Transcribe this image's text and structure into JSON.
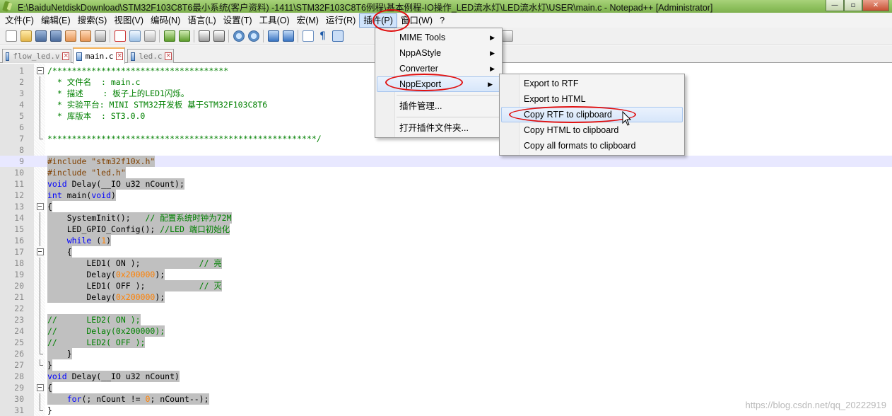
{
  "window": {
    "title": "E:\\BaiduNetdiskDownload\\STM32F103C8T6最小系统(客户资料) -1411\\STM32F103C8T6例程\\基本例程-IO操作_LED流水灯\\LED流水灯\\USER\\main.c - Notepad++ [Administrator]",
    "minimize_glyph": "—",
    "restore_glyph": "▫",
    "close_glyph": "✕"
  },
  "menubar": {
    "items": [
      "文件(F)",
      "编辑(E)",
      "搜索(S)",
      "视图(V)",
      "编码(N)",
      "语言(L)",
      "设置(T)",
      "工具(O)",
      "宏(M)",
      "运行(R)",
      "插件(P)",
      "窗口(W)",
      "?"
    ],
    "active_index": 10
  },
  "tabs": [
    {
      "label": "flow_led.v",
      "active": false
    },
    {
      "label": "main.c",
      "active": true
    },
    {
      "label": "led.c",
      "active": false
    }
  ],
  "plugins_menu": {
    "items": [
      {
        "label": "MIME Tools",
        "submenu": true
      },
      {
        "label": "NppAStyle",
        "submenu": true
      },
      {
        "label": "Converter",
        "submenu": true
      },
      {
        "label": "NppExport",
        "submenu": true,
        "highlighted": true
      },
      {
        "separator": true
      },
      {
        "label": "插件管理...",
        "submenu": false
      },
      {
        "separator": true
      },
      {
        "label": "打开插件文件夹...",
        "submenu": false
      }
    ],
    "arrow_glyph": "▶"
  },
  "nppexport_menu": {
    "items": [
      {
        "label": "Export to RTF",
        "highlighted": false
      },
      {
        "label": "Export to HTML",
        "highlighted": false
      },
      {
        "label": "Copy RTF to clipboard",
        "highlighted": true
      },
      {
        "label": "Copy HTML to clipboard",
        "highlighted": false
      },
      {
        "label": "Copy all formats to clipboard",
        "highlighted": false
      }
    ]
  },
  "editor": {
    "lines": [
      {
        "n": "1",
        "fold": "box",
        "sel": false,
        "tokens": [
          [
            "cmt",
            "/************************************"
          ]
        ]
      },
      {
        "n": "2",
        "fold": "vline",
        "sel": false,
        "tokens": [
          [
            "cmt",
            "  * 文件名  : main.c"
          ]
        ]
      },
      {
        "n": "3",
        "fold": "vline",
        "sel": false,
        "tokens": [
          [
            "cmt",
            "  * 描述    : 板子上的LED1闪烁。"
          ]
        ]
      },
      {
        "n": "4",
        "fold": "vline",
        "sel": false,
        "tokens": [
          [
            "cmt",
            "  * 实验平台: MINI STM32开发板 基于STM32F103C8T6"
          ]
        ]
      },
      {
        "n": "5",
        "fold": "vline",
        "sel": false,
        "tokens": [
          [
            "cmt",
            "  * 库版本  : ST3.0.0"
          ]
        ]
      },
      {
        "n": "6",
        "fold": "vline",
        "sel": false,
        "tokens": [
          [
            "cmt",
            ""
          ]
        ]
      },
      {
        "n": "7",
        "fold": "end",
        "sel": false,
        "tokens": [
          [
            "cmt",
            "*******************************************************/"
          ]
        ]
      },
      {
        "n": "8",
        "fold": "",
        "sel": false,
        "tokens": [
          [
            "txt",
            ""
          ]
        ]
      },
      {
        "n": "9",
        "fold": "",
        "sel": true,
        "current": true,
        "tokens": [
          [
            "pre",
            "#include \"stm32f10x.h\""
          ]
        ]
      },
      {
        "n": "10",
        "fold": "",
        "sel": true,
        "tokens": [
          [
            "pre",
            "#include \"led.h\""
          ]
        ]
      },
      {
        "n": "11",
        "fold": "",
        "sel": true,
        "tokens": [
          [
            "kw",
            "void"
          ],
          [
            "txt",
            " Delay(__IO u32 nCount);"
          ]
        ]
      },
      {
        "n": "12",
        "fold": "",
        "sel": true,
        "tokens": [
          [
            "kw",
            "int"
          ],
          [
            "txt",
            " main("
          ],
          [
            "kw",
            "void"
          ],
          [
            "txt",
            ")"
          ]
        ]
      },
      {
        "n": "13",
        "fold": "box",
        "sel": true,
        "tokens": [
          [
            "txt",
            "{"
          ]
        ]
      },
      {
        "n": "14",
        "fold": "vline",
        "sel": true,
        "tokens": [
          [
            "txt",
            "    SystemInit();   "
          ],
          [
            "cmt",
            "// 配置系统时钟为72M"
          ]
        ]
      },
      {
        "n": "15",
        "fold": "vline",
        "sel": true,
        "tokens": [
          [
            "txt",
            "    LED_GPIO_Config(); "
          ],
          [
            "cmt",
            "//LED 端口初始化"
          ]
        ]
      },
      {
        "n": "16",
        "fold": "vline",
        "sel": true,
        "tokens": [
          [
            "txt",
            "    "
          ],
          [
            "kw",
            "while"
          ],
          [
            "txt",
            " ("
          ],
          [
            "num",
            "1"
          ],
          [
            "txt",
            ")"
          ]
        ]
      },
      {
        "n": "17",
        "fold": "box",
        "sel": true,
        "tokens": [
          [
            "txt",
            "    {"
          ]
        ]
      },
      {
        "n": "18",
        "fold": "vline",
        "sel": true,
        "tokens": [
          [
            "txt",
            "        LED1( ON );            "
          ],
          [
            "cmt",
            "// 亮"
          ]
        ]
      },
      {
        "n": "19",
        "fold": "vline",
        "sel": true,
        "tokens": [
          [
            "txt",
            "        Delay("
          ],
          [
            "num",
            "0x200000"
          ],
          [
            "txt",
            ");"
          ]
        ]
      },
      {
        "n": "20",
        "fold": "vline",
        "sel": true,
        "tokens": [
          [
            "txt",
            "        LED1( OFF );           "
          ],
          [
            "cmt",
            "// 灭"
          ]
        ]
      },
      {
        "n": "21",
        "fold": "vline",
        "sel": true,
        "tokens": [
          [
            "txt",
            "        Delay("
          ],
          [
            "num",
            "0x200000"
          ],
          [
            "txt",
            ");"
          ]
        ]
      },
      {
        "n": "22",
        "fold": "vline",
        "sel": false,
        "tokens": [
          [
            "txt",
            ""
          ]
        ]
      },
      {
        "n": "23",
        "fold": "vline",
        "sel": true,
        "tokens": [
          [
            "cmt",
            "//      LED2( ON );"
          ]
        ]
      },
      {
        "n": "24",
        "fold": "vline",
        "sel": true,
        "tokens": [
          [
            "cmt",
            "//      Delay(0x200000);"
          ]
        ]
      },
      {
        "n": "25",
        "fold": "vline",
        "sel": true,
        "tokens": [
          [
            "cmt",
            "//      LED2( OFF );"
          ]
        ]
      },
      {
        "n": "26",
        "fold": "end",
        "sel": true,
        "tokens": [
          [
            "txt",
            "    }"
          ]
        ]
      },
      {
        "n": "27",
        "fold": "end",
        "sel": true,
        "tokens": [
          [
            "txt",
            "}"
          ]
        ]
      },
      {
        "n": "28",
        "fold": "",
        "sel": true,
        "tokens": [
          [
            "kw",
            "void"
          ],
          [
            "txt",
            " Delay(__IO u32 nCount)"
          ]
        ]
      },
      {
        "n": "29",
        "fold": "box",
        "sel": true,
        "tokens": [
          [
            "txt",
            "{"
          ]
        ]
      },
      {
        "n": "30",
        "fold": "vline",
        "sel": true,
        "tokens": [
          [
            "txt",
            "    "
          ],
          [
            "kw",
            "for"
          ],
          [
            "txt",
            "(; nCount != "
          ],
          [
            "num",
            "0"
          ],
          [
            "txt",
            "; nCount--);"
          ]
        ]
      },
      {
        "n": "31",
        "fold": "end",
        "sel": false,
        "tokens": [
          [
            "txt",
            "}"
          ]
        ]
      }
    ]
  },
  "watermark": "https://blog.csdn.net/qq_20222919"
}
